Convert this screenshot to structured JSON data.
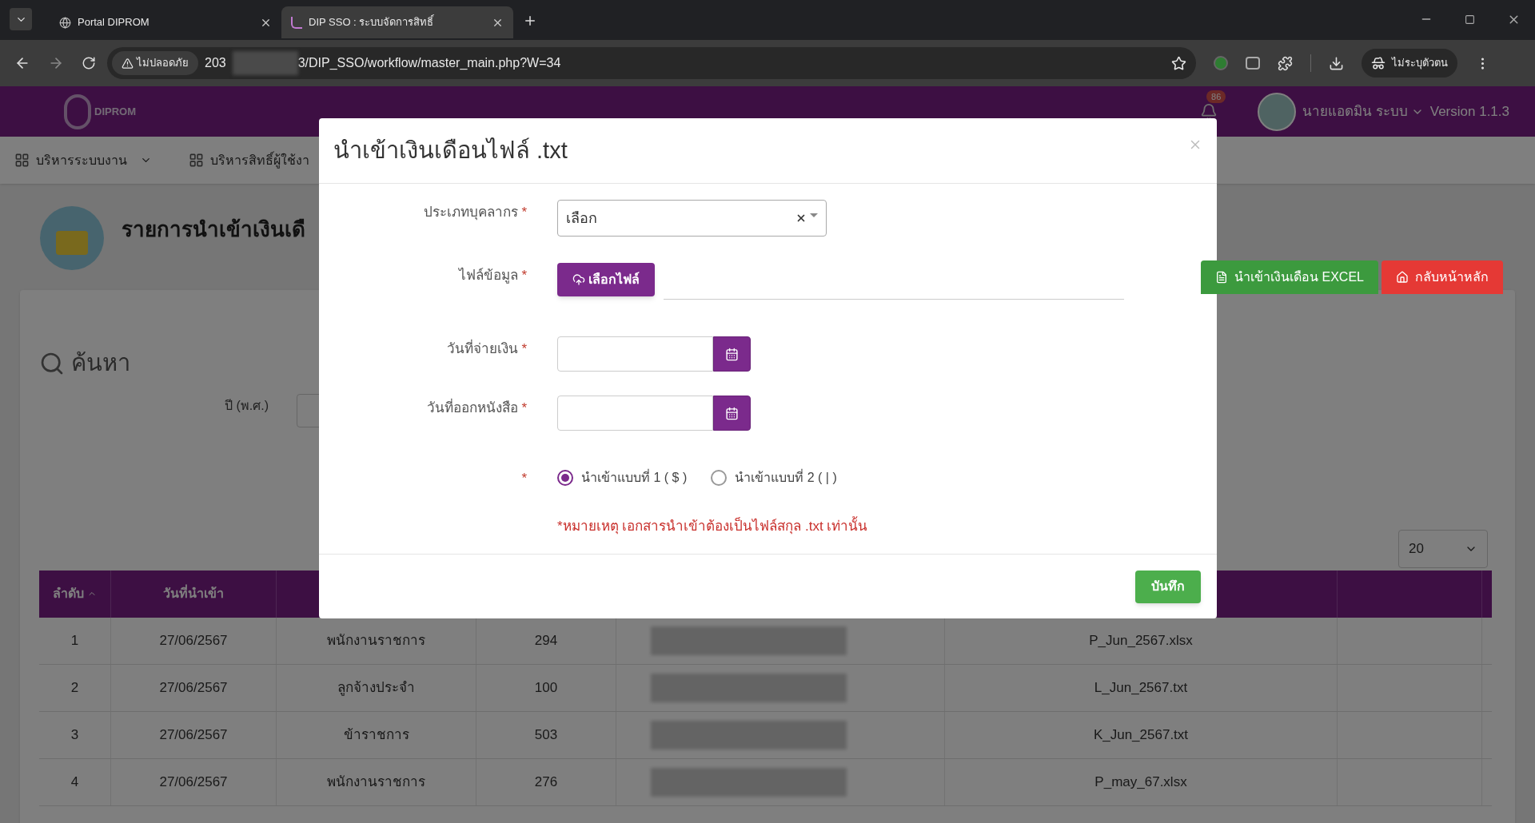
{
  "browser": {
    "tabs": [
      {
        "title": "Portal DIPROM",
        "selected": false
      },
      {
        "title": "DIP SSO : ระบบจัดการสิทธิ์",
        "selected": true
      }
    ],
    "security_chip": "ไม่ปลอดภัย",
    "url_start": "203",
    "url_end": "3/DIP_SSO/workflow/master_main.php?W=34",
    "profile": "ไม่ระบุตัวตน"
  },
  "header": {
    "logo": "DIPROM",
    "notification_count": "86",
    "user": "นายแอดมิน ระบบ",
    "version": "Version 1.1.3"
  },
  "menu": [
    {
      "label": "บริหารระบบงาน",
      "dropdown": true
    },
    {
      "label": "บริหารสิทธิ์ผู้ใช้งา",
      "dropdown": false
    }
  ],
  "page": {
    "title": "รายการนำเข้าเงินเดื",
    "search_title": "ค้นหา",
    "year_label": "ปี (พ.ศ.)",
    "buttons": [
      {
        "label": "นำเข้าเงินเดือน EXCEL",
        "kind": "excel"
      },
      {
        "label": "กลับหน้าหลัก",
        "kind": "home"
      }
    ],
    "page_size": "20"
  },
  "table": {
    "columns": [
      "ลำดับ",
      "วันที่นำเข้า"
    ],
    "rows": [
      {
        "cells": [
          "1",
          "27/06/2567",
          "พนักงานราชการ",
          "294",
          "P_Jun_2567.xlsx"
        ]
      },
      {
        "cells": [
          "2",
          "27/06/2567",
          "ลูกจ้างประจำ",
          "100",
          "L_Jun_2567.txt"
        ]
      },
      {
        "cells": [
          "3",
          "27/06/2567",
          "ข้าราชการ",
          "503",
          "K_Jun_2567.txt"
        ]
      },
      {
        "cells": [
          "4",
          "27/06/2567",
          "พนักงานราชการ",
          "276",
          "P_may_67.xlsx"
        ]
      }
    ]
  },
  "modal": {
    "title": "นำเข้าเงินเดือนไฟล์ .txt",
    "required_mark": "*",
    "fields": [
      {
        "kind": "select",
        "label": "ประเภทบุคลากร",
        "value": "เลือก",
        "required": true
      },
      {
        "kind": "file",
        "label": "ไฟล์ข้อมูล",
        "button": "เลือกไฟล์",
        "required": true
      },
      {
        "kind": "date",
        "label": "วันที่จ่ายเงิน",
        "required": true
      },
      {
        "kind": "date",
        "label": "วันที่ออกหนังสือ",
        "required": true
      },
      {
        "kind": "radio",
        "required": true,
        "options": [
          {
            "label": "นำเข้าแบบที่ 1 ( $ )",
            "selected": true
          },
          {
            "label": "นำเข้าแบบที่ 2 ( | )",
            "selected": false
          }
        ]
      }
    ],
    "note": "*หมายเหตุ เอกสารนำเข้าต้องเป็นไฟล์สกุล .txt เท่านั้น",
    "save": "บันทึก"
  }
}
